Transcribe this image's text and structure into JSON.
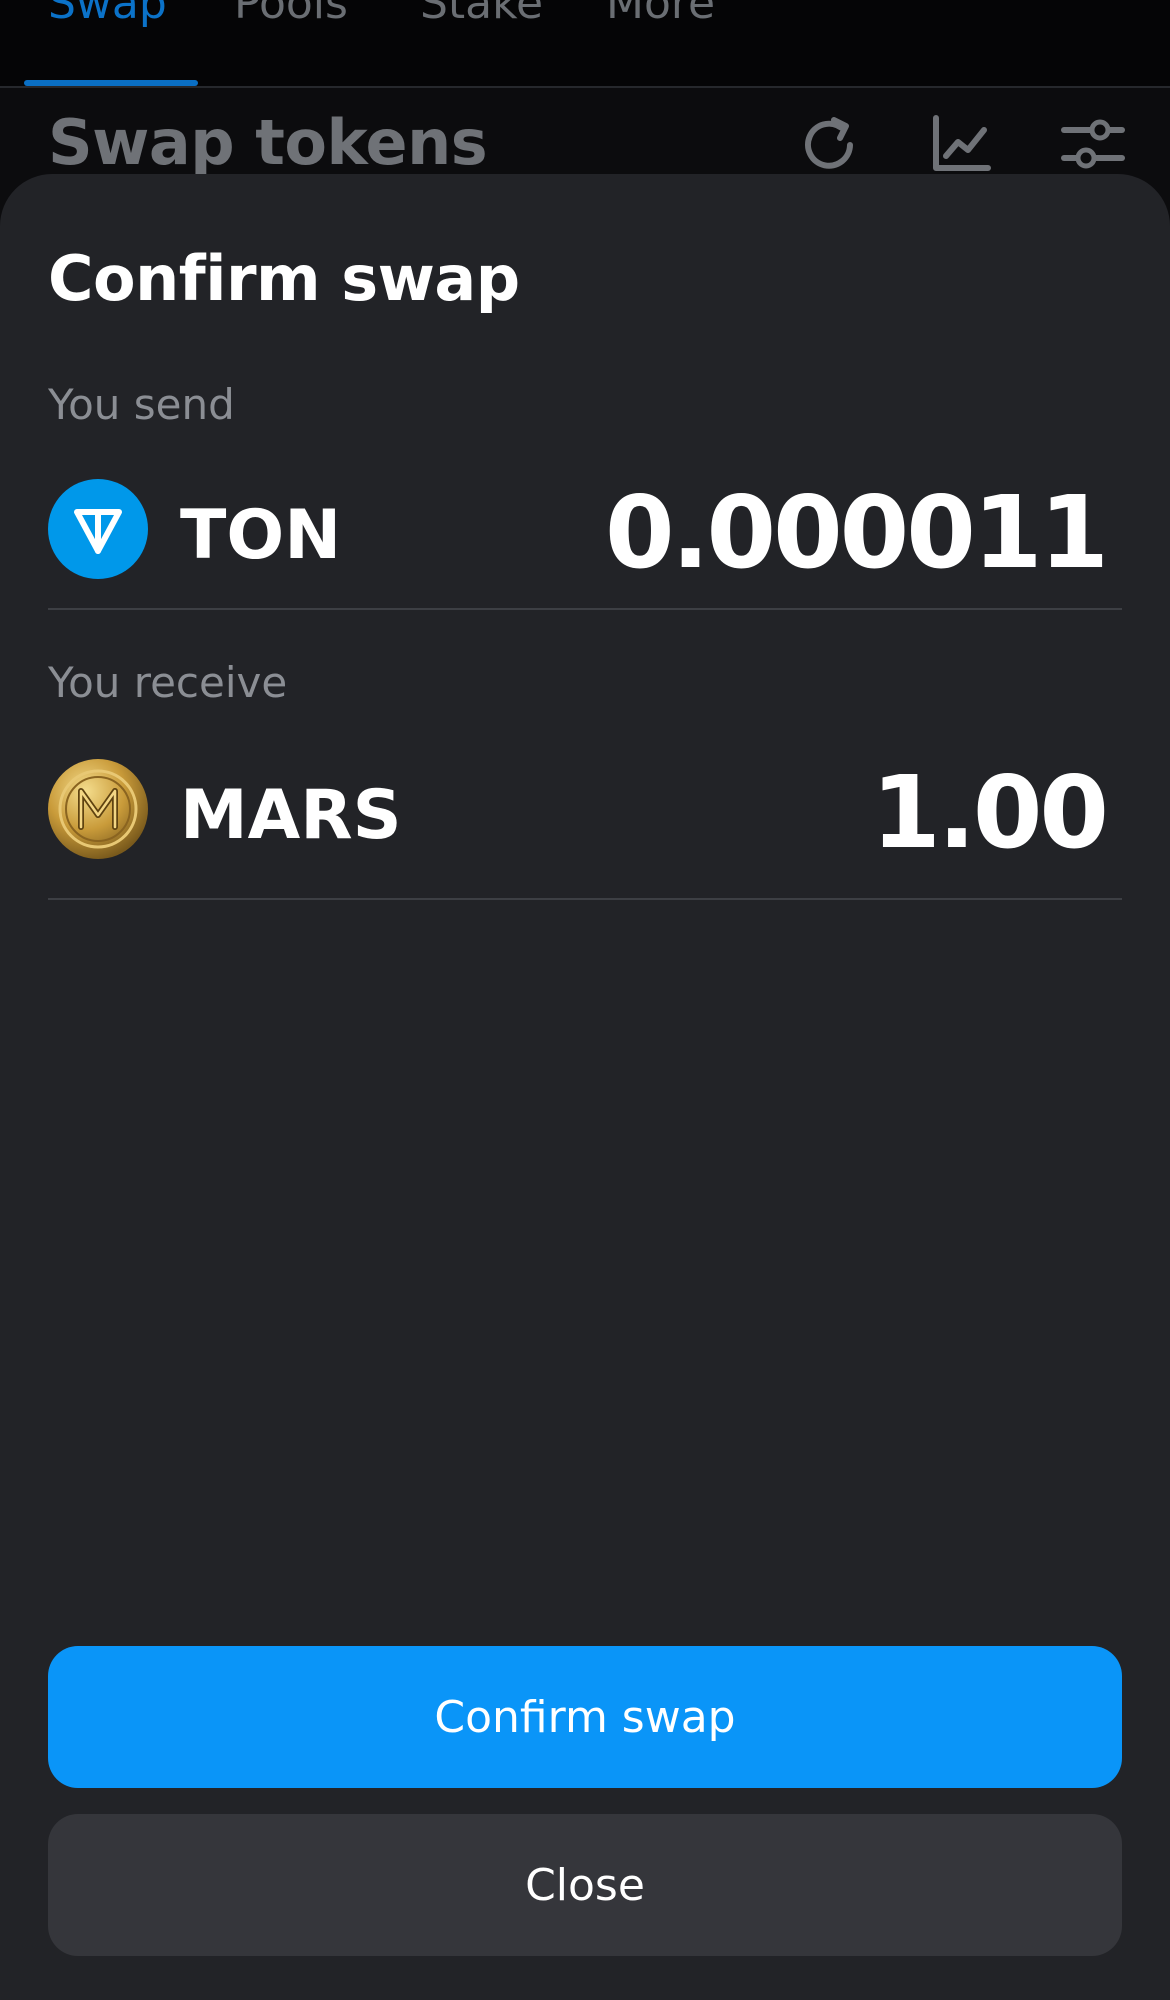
{
  "nav": {
    "tabs": [
      {
        "label": "Swap",
        "active": true
      },
      {
        "label": "Pools",
        "active": false
      },
      {
        "label": "Stake",
        "active": false
      },
      {
        "label": "More",
        "active": false
      }
    ]
  },
  "page": {
    "title": "Swap tokens",
    "actions": [
      "refresh-icon",
      "chart-icon",
      "settings-sliders-icon"
    ]
  },
  "modal": {
    "title": "Confirm swap",
    "send": {
      "label": "You send",
      "token": "TON",
      "amount": "0.000011",
      "icon": "ton-logo-icon"
    },
    "receive": {
      "label": "You receive",
      "token": "MARS",
      "amount": "1.00",
      "icon": "mars-coin-icon"
    },
    "confirm_label": "Confirm swap",
    "close_label": "Close"
  },
  "colors": {
    "accent": "#0a95f8",
    "ton_blue": "#0098ea",
    "sheet_bg": "#222327",
    "secondary_button": "#35363b"
  }
}
